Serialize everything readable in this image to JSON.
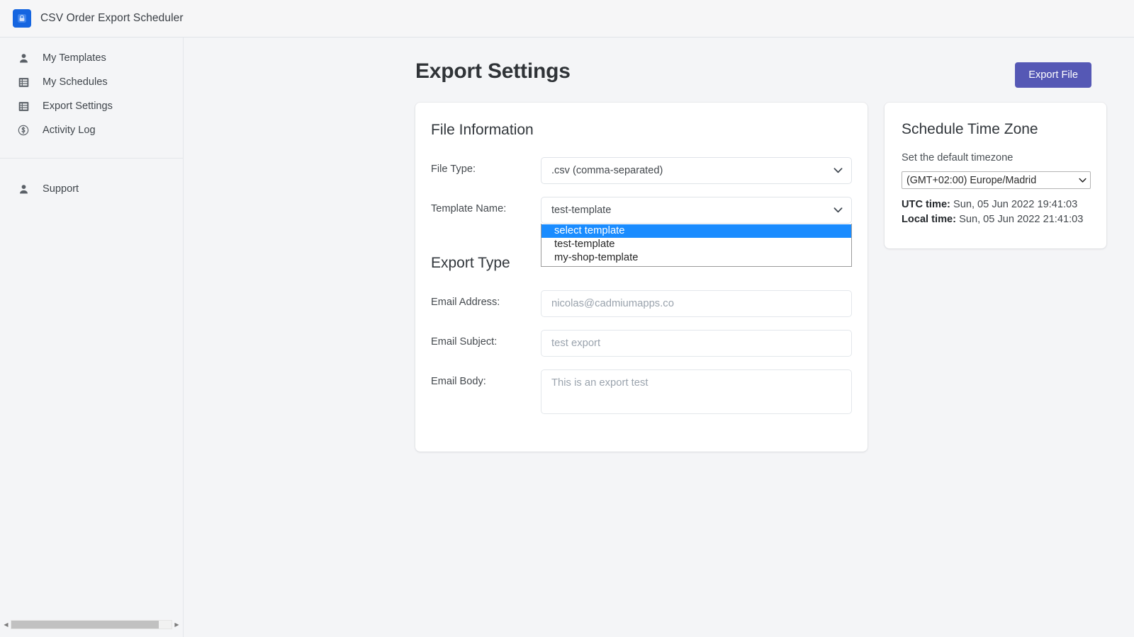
{
  "app": {
    "title": "CSV Order Export Scheduler",
    "logo_icon": "lock-icon"
  },
  "sidebar": {
    "primary_items": [
      {
        "label": "My Templates",
        "icon": "person-icon"
      },
      {
        "label": "My Schedules",
        "icon": "list-icon"
      },
      {
        "label": "Export Settings",
        "icon": "list-icon"
      },
      {
        "label": "Activity Log",
        "icon": "dollar-circle-icon"
      }
    ],
    "secondary_items": [
      {
        "label": "Support",
        "icon": "person-icon"
      }
    ],
    "scrollbar": {
      "left_arrow": "◀",
      "right_arrow": "▶"
    }
  },
  "page": {
    "title": "Export Settings",
    "export_button": "Export File"
  },
  "file_information": {
    "heading": "File Information",
    "file_type": {
      "label": "File Type:",
      "value": ".csv (comma-separated)"
    },
    "template_name": {
      "label": "Template Name:",
      "value": "test-template",
      "open": true,
      "options": [
        {
          "label": "select template",
          "highlighted": true
        },
        {
          "label": "test-template",
          "highlighted": false
        },
        {
          "label": "my-shop-template",
          "highlighted": false
        }
      ]
    }
  },
  "export_type": {
    "heading": "Export Type",
    "email_address": {
      "label": "Email Address:",
      "value": "",
      "placeholder": "nicolas@cadmiumapps.co"
    },
    "email_subject": {
      "label": "Email Subject:",
      "value": "",
      "placeholder": "test export"
    },
    "email_body": {
      "label": "Email Body:",
      "value": "",
      "placeholder": "This is an export test"
    }
  },
  "schedule_time_zone": {
    "heading": "Schedule Time Zone",
    "subtitle": "Set the default timezone",
    "selected_timezone": "(GMT+02:00) Europe/Madrid",
    "utc_label": "UTC time:",
    "utc_value": "Sun, 05 Jun 2022 19:41:03",
    "local_label": "Local time:",
    "local_value": "Sun, 05 Jun 2022 21:41:03"
  },
  "colors": {
    "accent_button": "#5558b5",
    "logo_blue": "#1565e0",
    "dropdown_highlight": "#1a8cff",
    "page_background": "#f4f5f7"
  }
}
